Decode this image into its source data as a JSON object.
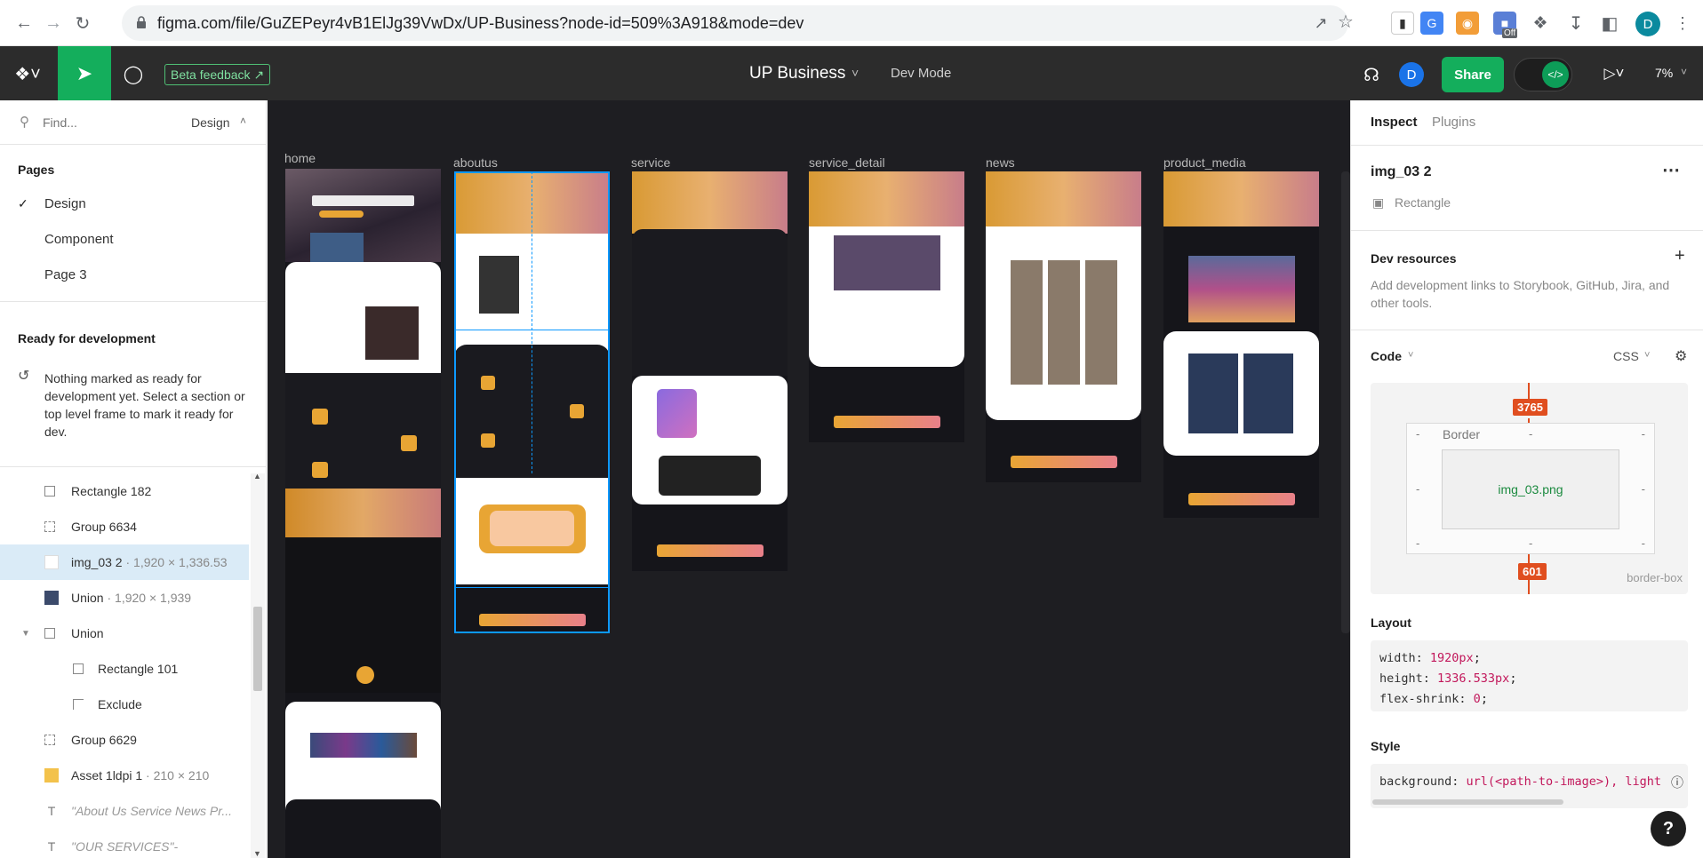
{
  "browser": {
    "url": "figma.com/file/GuZEPeyr4vB1ElJg39VwDx/UP-Business?node-id=509%3A918&mode=dev",
    "profile_initial": "D",
    "ext_badge": "Off"
  },
  "toolbar": {
    "file_title": "UP Business",
    "mode_label": "Dev Mode",
    "beta_label": "Beta feedback",
    "user_initial": "D",
    "share_label": "Share",
    "zoom": "7%"
  },
  "left": {
    "search_placeholder": "Find...",
    "panel_label": "Design",
    "pages_title": "Pages",
    "pages": [
      "Design",
      "Component",
      "Page 3"
    ],
    "ready_title": "Ready for development",
    "ready_text": "Nothing marked as ready for development yet. Select a section or top level frame to mark it ready for dev.",
    "layers": [
      {
        "name": "Rectangle 182",
        "dim": "",
        "icon": "rectangle"
      },
      {
        "name": "Group 6634",
        "dim": "",
        "icon": "group"
      },
      {
        "name": "img_03 2",
        "dim": " · 1,920 × 1,336.53",
        "icon": "image"
      },
      {
        "name": "Union",
        "dim": " · 1,920 × 1,939",
        "icon": "image"
      },
      {
        "name": "Union",
        "dim": "",
        "icon": "rectangle"
      },
      {
        "name": "Rectangle 101",
        "dim": "",
        "icon": "rectangle"
      },
      {
        "name": "Exclude",
        "dim": "",
        "icon": "exclude"
      },
      {
        "name": "Group 6629",
        "dim": "",
        "icon": "group"
      },
      {
        "name": "Asset 1ldpi 1",
        "dim": " · 210 × 210",
        "icon": "image"
      },
      {
        "name": "\"About Us Service News Pr...",
        "dim": "",
        "icon": "text"
      },
      {
        "name": "\"OUR SERVICES\"-",
        "dim": "",
        "icon": "text"
      }
    ]
  },
  "canvas": {
    "frames": [
      "home",
      "aboutus",
      "service",
      "service_detail",
      "news",
      "product_media"
    ]
  },
  "right": {
    "tabs": [
      "Inspect",
      "Plugins"
    ],
    "layer_name": "img_03 2",
    "layer_type": "Rectangle",
    "dev_resources_title": "Dev resources",
    "dev_resources_text": "Add development links to Storybook, GitHub, Jira, and other tools.",
    "code_title": "Code",
    "code_lang": "CSS",
    "box": {
      "top": "3765",
      "bottom": "601",
      "border_label": "Border",
      "content": "img_03.png",
      "sizing": "border-box",
      "dash": "-"
    },
    "layout_title": "Layout",
    "layout_code": [
      {
        "prop": "width: ",
        "value": "1920px",
        "end": ";"
      },
      {
        "prop": "height: ",
        "value": "1336.533px",
        "end": ";"
      },
      {
        "prop": "flex-shrink: ",
        "value": "0",
        "end": ";"
      }
    ],
    "style_title": "Style",
    "style_code": {
      "prop": "background: ",
      "value": "url(<path-to-image>), ",
      "tail": "light"
    },
    "help": "?"
  },
  "colors": {
    "accent": "#e8a534",
    "figma_green": "#14ae5c",
    "select_blue": "#0d99ff",
    "red": "#e04e1f"
  }
}
